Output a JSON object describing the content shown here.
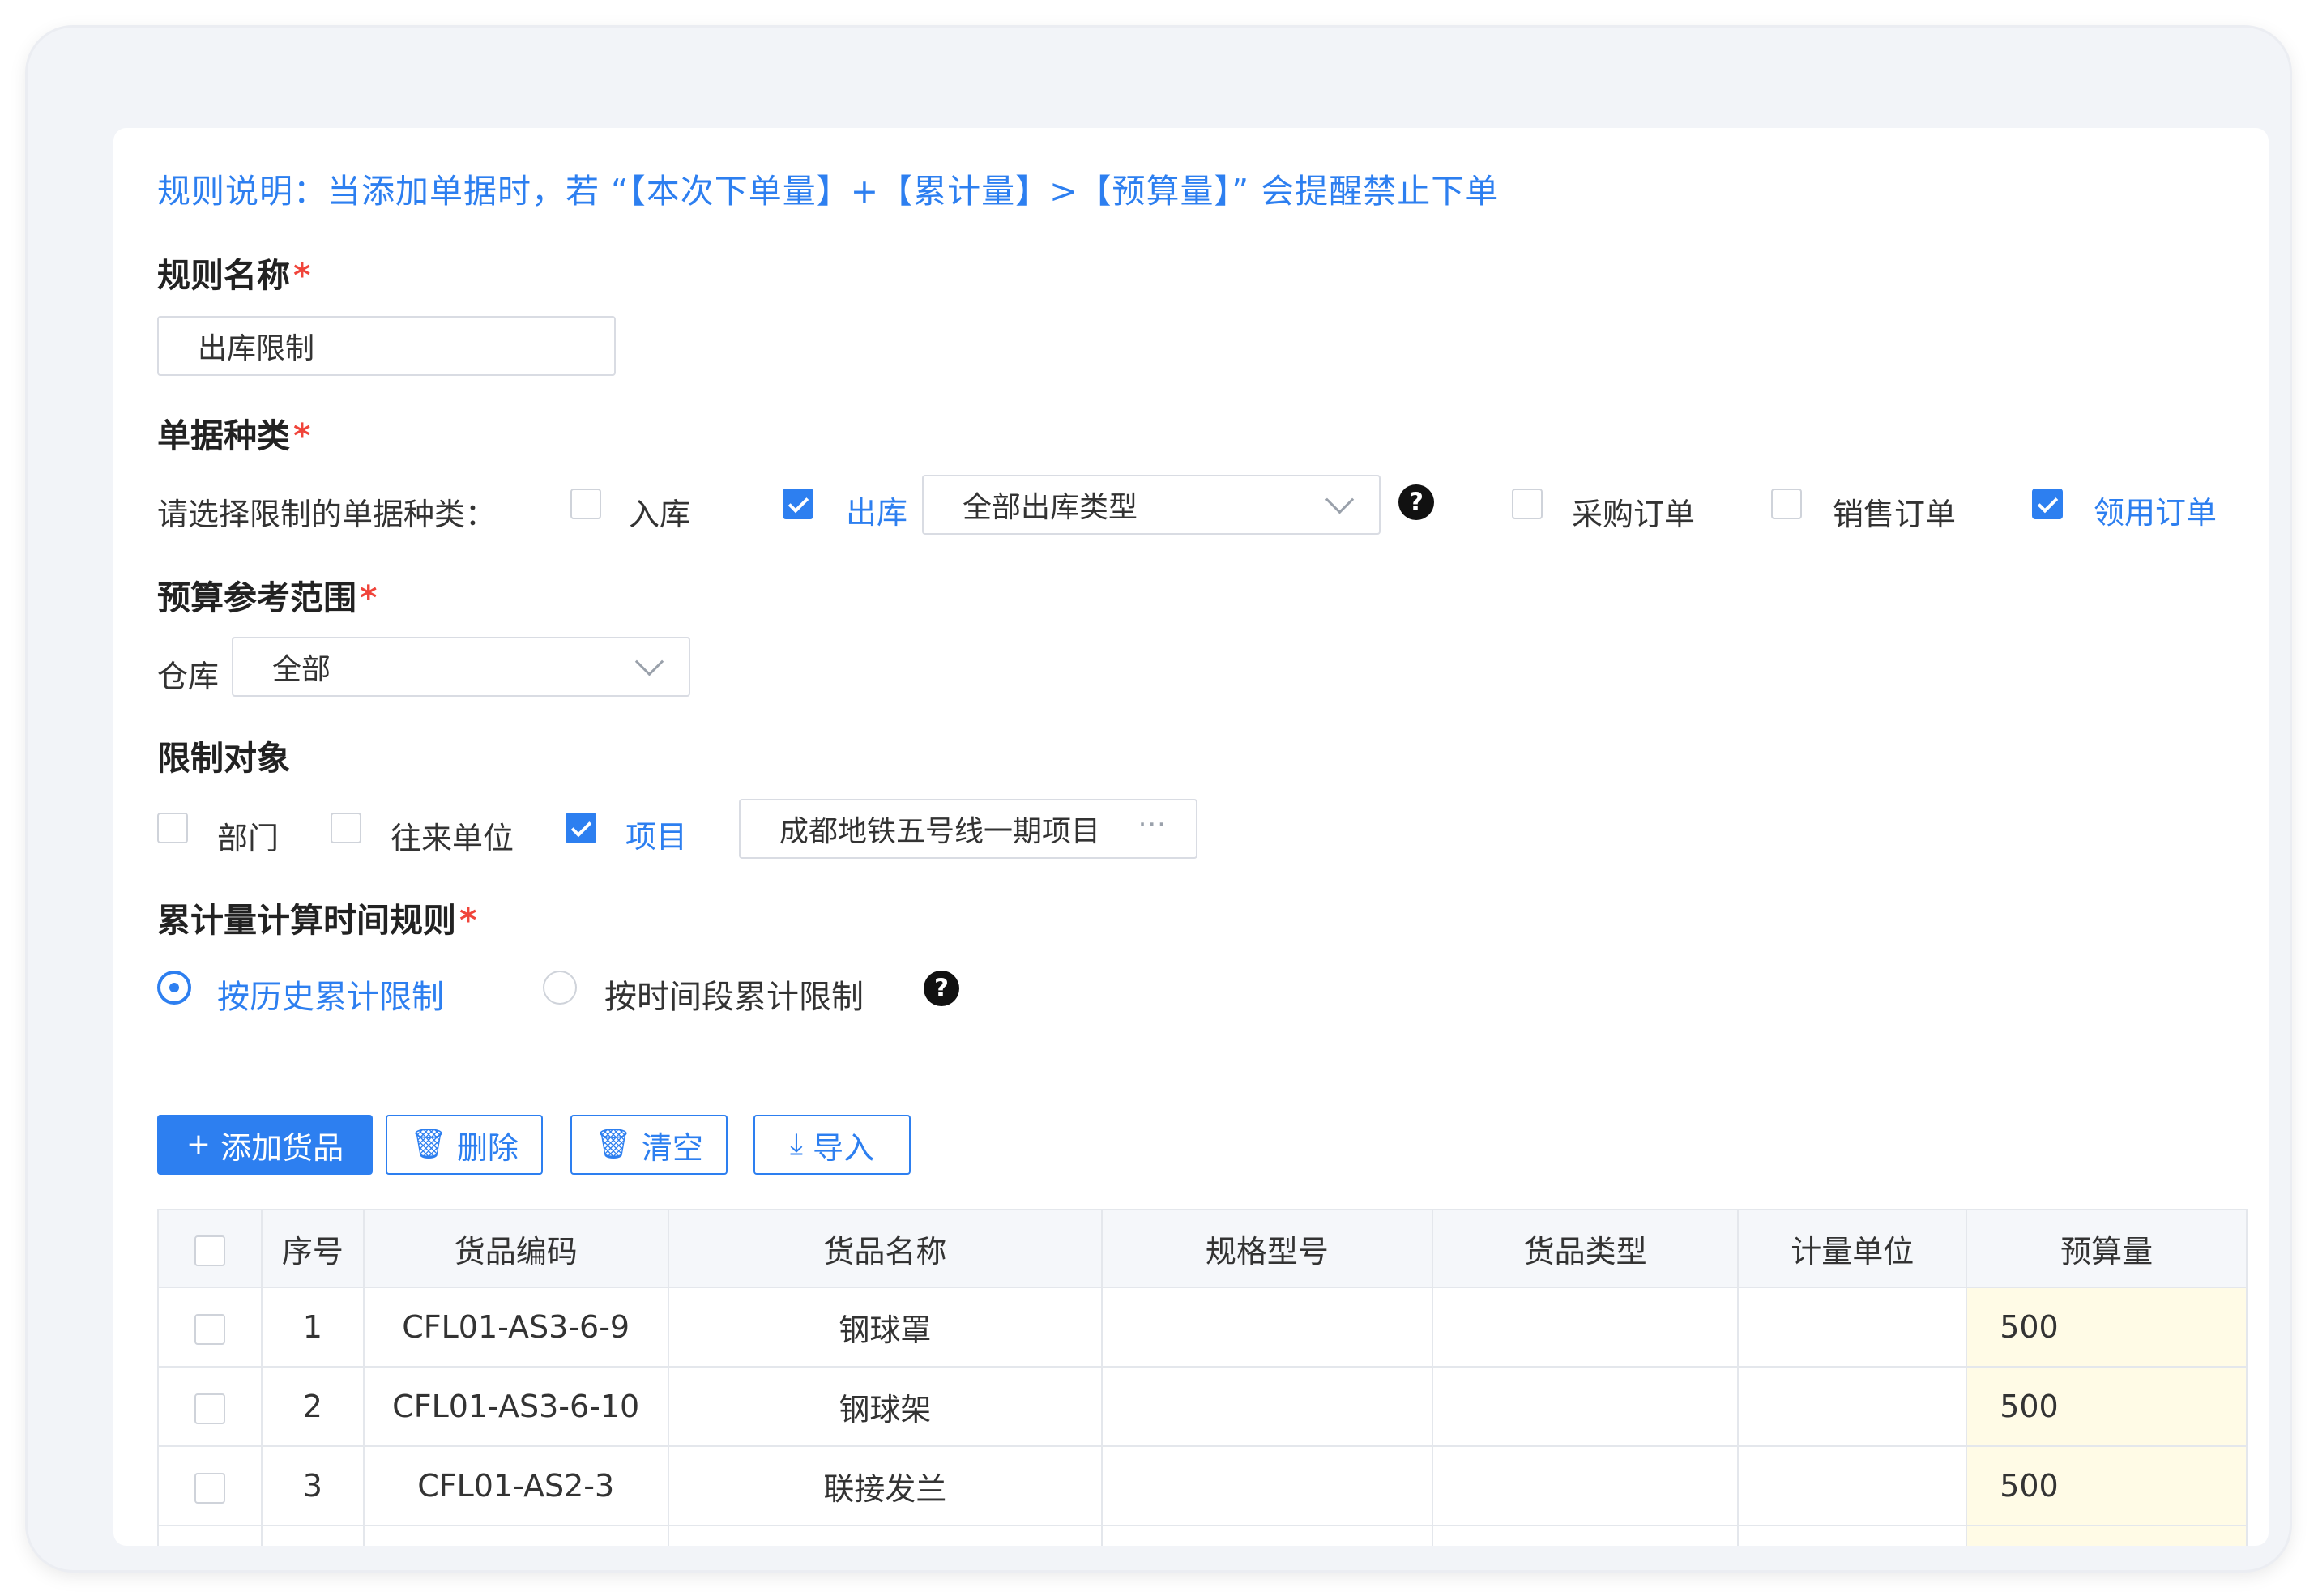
{
  "rule_note": "规则说明：当添加单据时，若 “【本次下单量】+【累计量】>【预算量】” 会提醒禁止下单",
  "rule_name": {
    "label": "规则名称",
    "required_mark": "*",
    "value": "出库限制"
  },
  "doc_type": {
    "label": "单据种类",
    "required_mark": "*",
    "prompt": "请选择限制的单据种类：",
    "options": [
      {
        "label": "入库",
        "checked": false
      },
      {
        "label": "出库",
        "checked": true
      },
      {
        "label": "采购订单",
        "checked": false
      },
      {
        "label": "销售订单",
        "checked": false
      },
      {
        "label": "领用订单",
        "checked": true
      }
    ],
    "outbound_type_select": "全部出库类型",
    "help_icon": "question-circle-icon"
  },
  "budget_scope": {
    "label": "预算参考范围",
    "required_mark": "*",
    "warehouse_label": "仓库",
    "warehouse_value": "全部"
  },
  "restrict_target": {
    "label": "限制对象",
    "options": [
      {
        "label": "部门",
        "checked": false
      },
      {
        "label": "往来单位",
        "checked": false
      },
      {
        "label": "项目",
        "checked": true
      }
    ],
    "project_value": "成都地铁五号线一期项目",
    "more_icon": "···"
  },
  "time_rule": {
    "label": "累计量计算时间规则",
    "required_mark": "*",
    "options": [
      {
        "label": "按历史累计限制",
        "selected": true
      },
      {
        "label": "按时间段累计限制",
        "selected": false
      }
    ],
    "help_icon": "question-circle-icon"
  },
  "toolbar": {
    "add": {
      "icon": "+",
      "label": "添加货品"
    },
    "delete": {
      "icon": "🗑",
      "label": "删除"
    },
    "clear": {
      "icon": "🗑",
      "label": "清空"
    },
    "import": {
      "icon": "⤓",
      "label": "导入"
    }
  },
  "table": {
    "columns": [
      "序号",
      "货品编码",
      "货品名称",
      "规格型号",
      "货品类型",
      "计量单位",
      "预算量"
    ],
    "rows": [
      {
        "index": "1",
        "code": "CFL01-AS3-6-9",
        "name": "钢球罩",
        "spec": "",
        "type": "",
        "unit": "",
        "budget": "500"
      },
      {
        "index": "2",
        "code": "CFL01-AS3-6-10",
        "name": "钢球架",
        "spec": "",
        "type": "",
        "unit": "",
        "budget": "500"
      },
      {
        "index": "3",
        "code": "CFL01-AS2-3",
        "name": "联接发兰",
        "spec": "",
        "type": "",
        "unit": "",
        "budget": "500"
      }
    ]
  },
  "colors": {
    "accent": "#2d7ff0",
    "required": "#f0443a",
    "budget_cell": "#fffbe6"
  }
}
